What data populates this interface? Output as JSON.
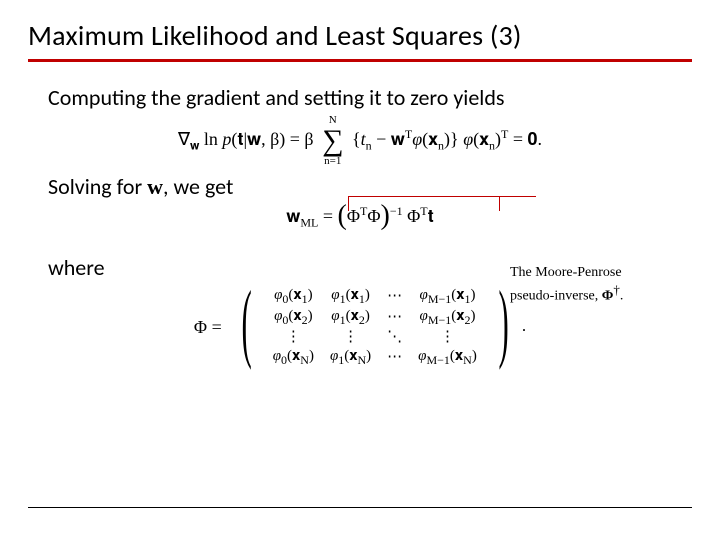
{
  "title": "Maximum Likelihood and Least Squares (3)",
  "line_gradient": "Computing the gradient and setting it to zero yields",
  "eq_gradient": "∇𝐰 ln p(𝐭|𝐰, β) = β ∑ {tₙ − 𝐰ᵀφ(𝐱ₙ)} φ(𝐱ₙ)ᵀ = 𝟎.",
  "sum_top": "N",
  "sum_bottom": "n=1",
  "line_solving_pre": "Solving for ",
  "line_solving_w": "w",
  "line_solving_post": ", we get",
  "eq_wml_lhs": "𝐰ML",
  "eq_wml_inner": "Φᵀ Φ",
  "eq_wml_tail": "Φᵀ 𝐭",
  "callout_l1": "The Moore-Penrose",
  "callout_l2_pre": "pseudo-inverse,  ",
  "callout_phi": "Φ",
  "callout_dagger": "†",
  "callout_l2_post": ".",
  "line_where": "where",
  "phi_label": "Φ  =",
  "matrix": {
    "r1": [
      "φ₀(𝐱₁)",
      "φ₁(𝐱₁)",
      "⋯",
      "φ_{M−1}(𝐱₁)"
    ],
    "r2": [
      "φ₀(𝐱₂)",
      "φ₁(𝐱₂)",
      "⋯",
      "φ_{M−1}(𝐱₂)"
    ],
    "r3": [
      "⋮",
      "⋮",
      "⋱",
      "⋮"
    ],
    "r4": [
      "φ₀(𝐱_N)",
      "φ₁(𝐱_N)",
      "⋯",
      "φ_{M−1}(𝐱_N)"
    ]
  },
  "matrix_period": "."
}
